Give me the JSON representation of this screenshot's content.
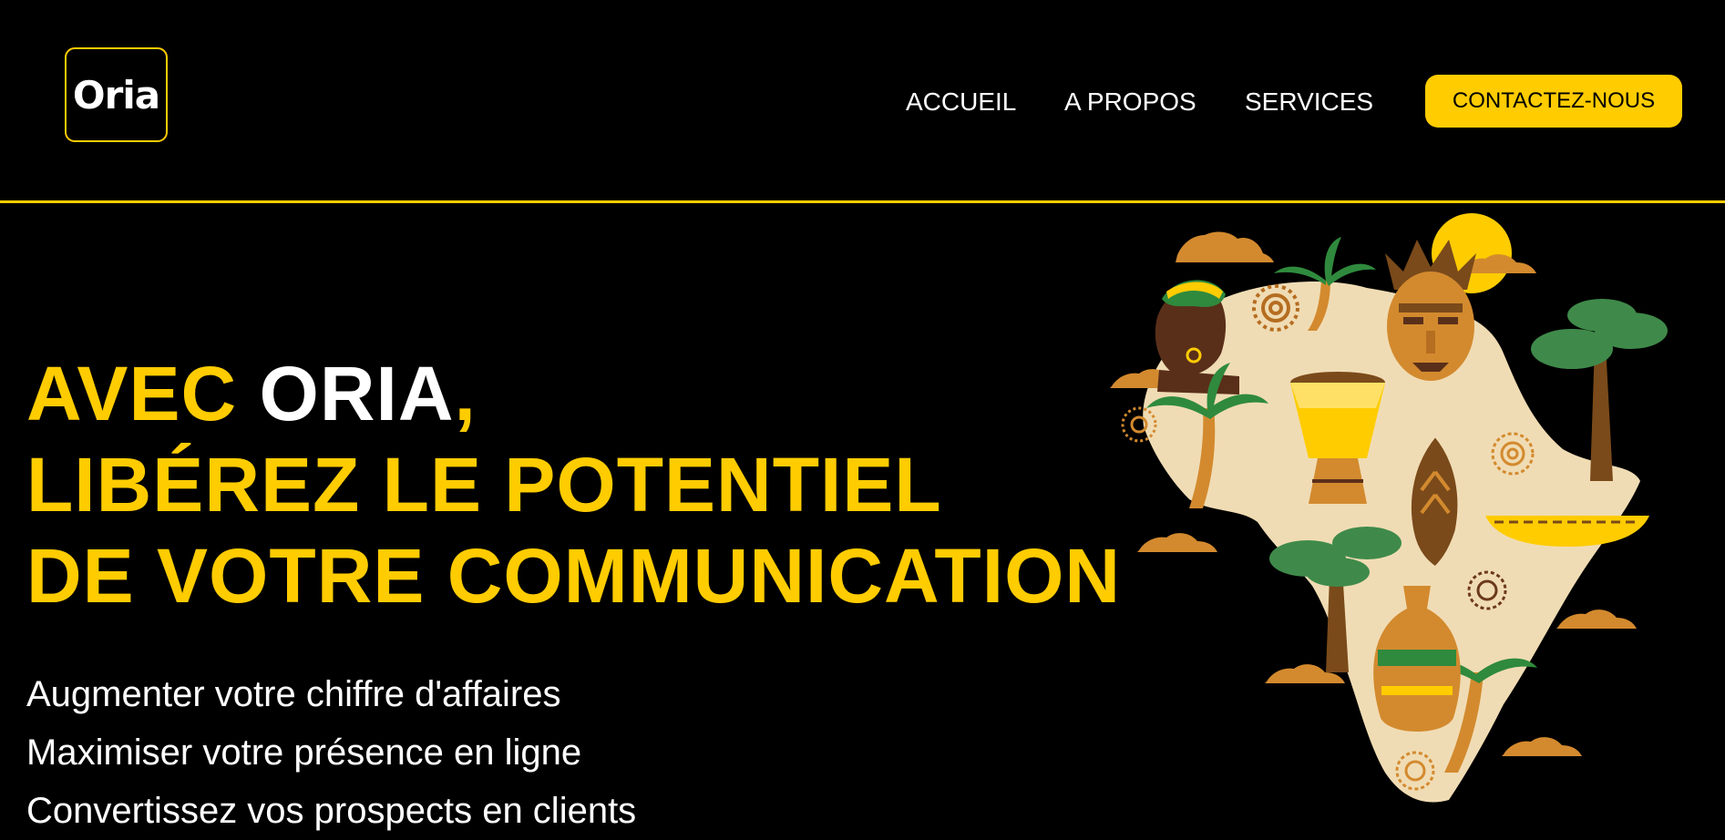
{
  "header": {
    "logo_text": "Oria",
    "nav": {
      "items": [
        "ACCUEIL",
        "A PROPOS",
        "SERVICES"
      ],
      "cta_label": "CONTACTEZ-NOUS"
    }
  },
  "hero": {
    "title": {
      "line1_prefix": "AVEC ",
      "line1_brand": "ORIA",
      "line1_suffix": ",",
      "line2": "LIBÉREZ LE POTENTIEL",
      "line3": "DE VOTRE COMMUNICATION"
    },
    "benefits": [
      "Augmenter votre chiffre d'affaires",
      "Maximiser votre présence en ligne",
      "Convertissez vos prospects en clients"
    ]
  },
  "illustration": {
    "icons": [
      "africa-map-icon",
      "sun-icon",
      "cloud-icon",
      "palm-tree-icon",
      "baobab-tree-icon",
      "african-woman-icon",
      "tribal-mask-icon",
      "djembe-drum-icon",
      "shield-icon",
      "vase-icon",
      "spiral-icon",
      "woven-basket-icon"
    ]
  },
  "colors": {
    "background": "#000000",
    "accent": "#ffcc00",
    "text": "#ffffff",
    "map": "#f0dcb4"
  }
}
